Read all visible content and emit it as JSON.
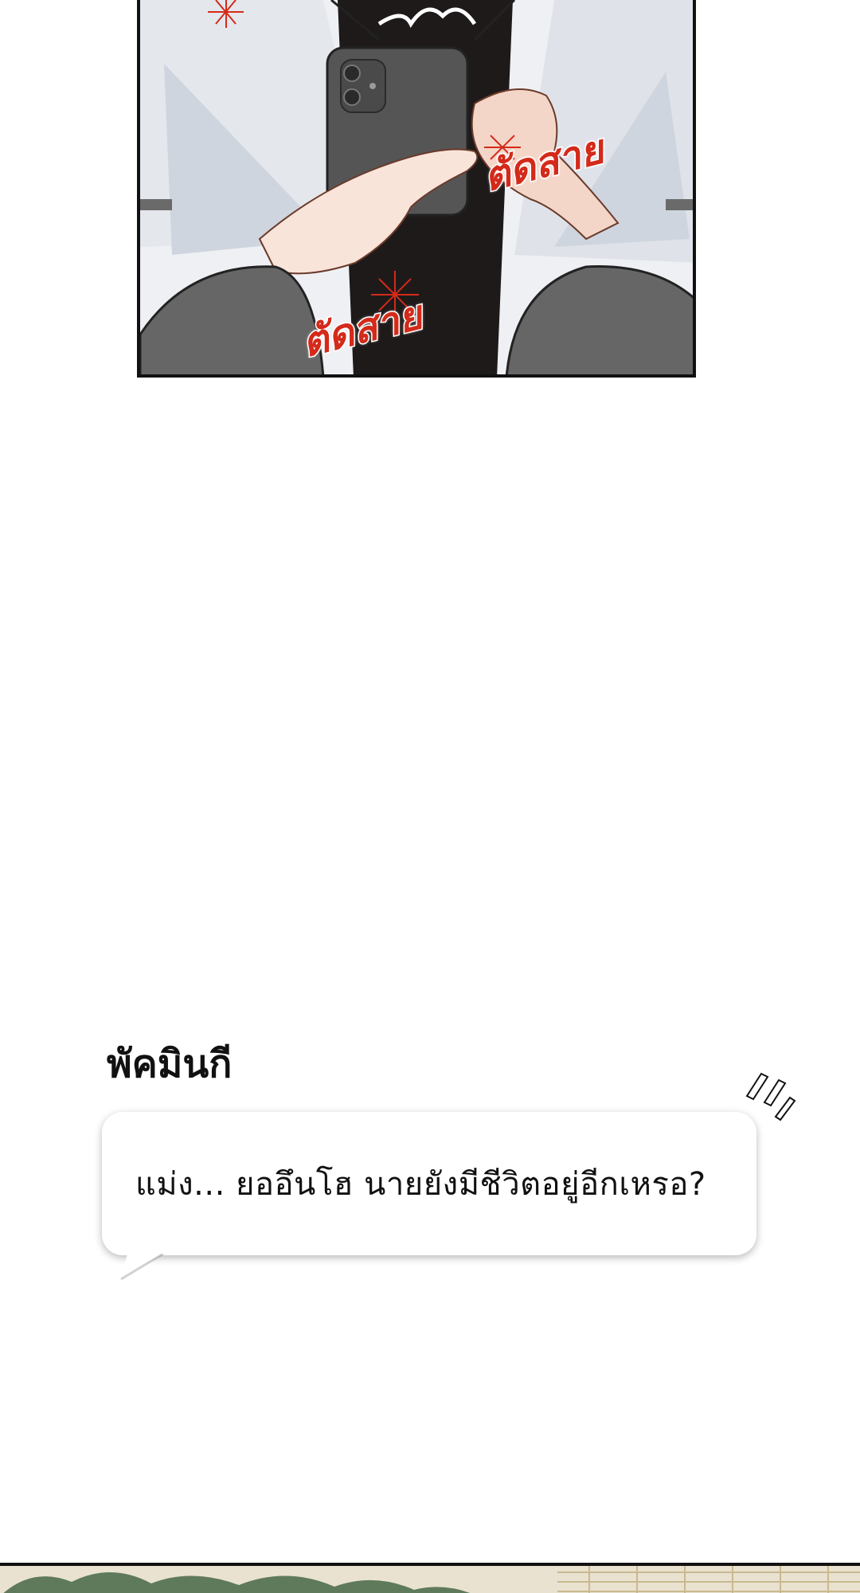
{
  "panel_top": {
    "sfx": [
      "ตัดสาย",
      "ตัดสาย"
    ]
  },
  "dialogue": {
    "speaker": "พัคมินกี",
    "line": "แม่ง... ยออึนโฮ นายยังมีชีวิตอยู่อีกเหรอ?"
  },
  "colors": {
    "sfx_red": "#d42a1a",
    "phone": "#555555",
    "tie": "#1e1a1a",
    "skin": "#f4d6c8",
    "sleeve_gray": "#666666",
    "foliage_green": "#5f7a5a"
  }
}
